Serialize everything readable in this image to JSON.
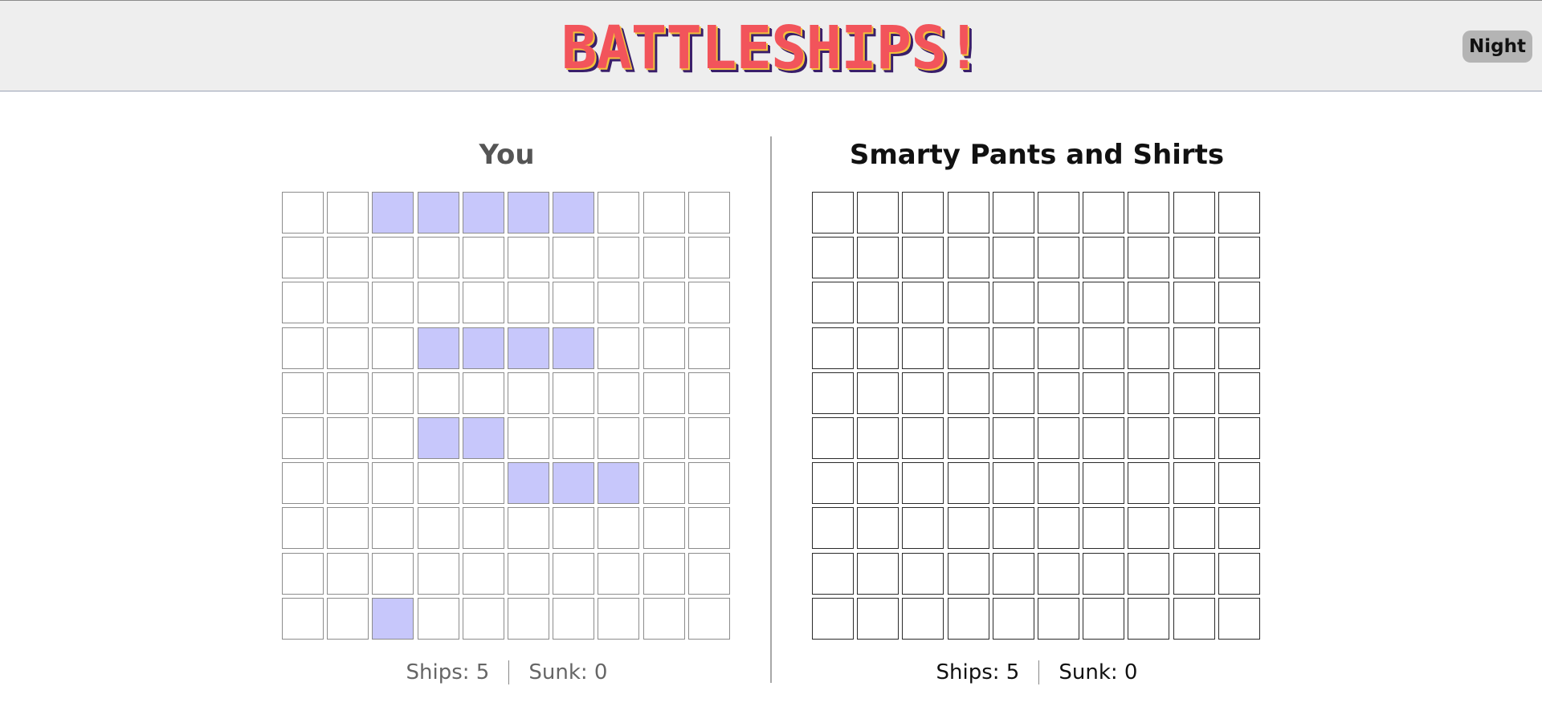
{
  "header": {
    "title": "BATTLESHIPS!",
    "night_label": "Night"
  },
  "player": {
    "name": "You",
    "ships_label": "Ships: 5",
    "sunk_label": "Sunk: 0",
    "ship_cells": [
      [
        0,
        2
      ],
      [
        0,
        3
      ],
      [
        0,
        4
      ],
      [
        0,
        5
      ],
      [
        0,
        6
      ],
      [
        3,
        3
      ],
      [
        3,
        4
      ],
      [
        3,
        5
      ],
      [
        3,
        6
      ],
      [
        5,
        3
      ],
      [
        5,
        4
      ],
      [
        6,
        5
      ],
      [
        6,
        6
      ],
      [
        6,
        7
      ],
      [
        9,
        2
      ]
    ]
  },
  "opponent": {
    "name": "Smarty Pants and Shirts",
    "ships_label": "Ships: 5",
    "sunk_label": "Sunk: 0"
  },
  "colors": {
    "title": "#f2545b",
    "ship_cell": "#c7c7fb",
    "header_bg": "#eeeeee"
  }
}
